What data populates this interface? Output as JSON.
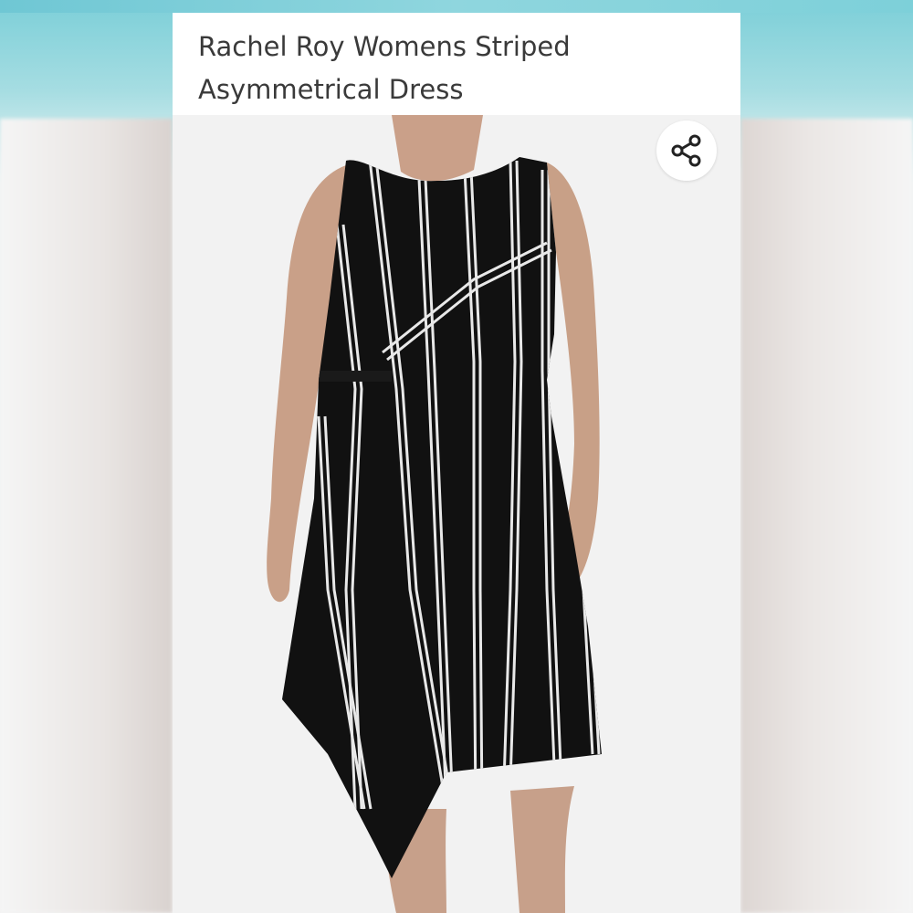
{
  "product": {
    "title": "Rachel Roy Womens Striped Asymmetrical Dress"
  },
  "actions": {
    "share_icon": "share-icon"
  },
  "colors": {
    "dress": "#111111",
    "stripe": "#e8e8e8",
    "skin": "#c9a088",
    "background": "#f3f3f3",
    "title_text": "#3a3a3a"
  }
}
